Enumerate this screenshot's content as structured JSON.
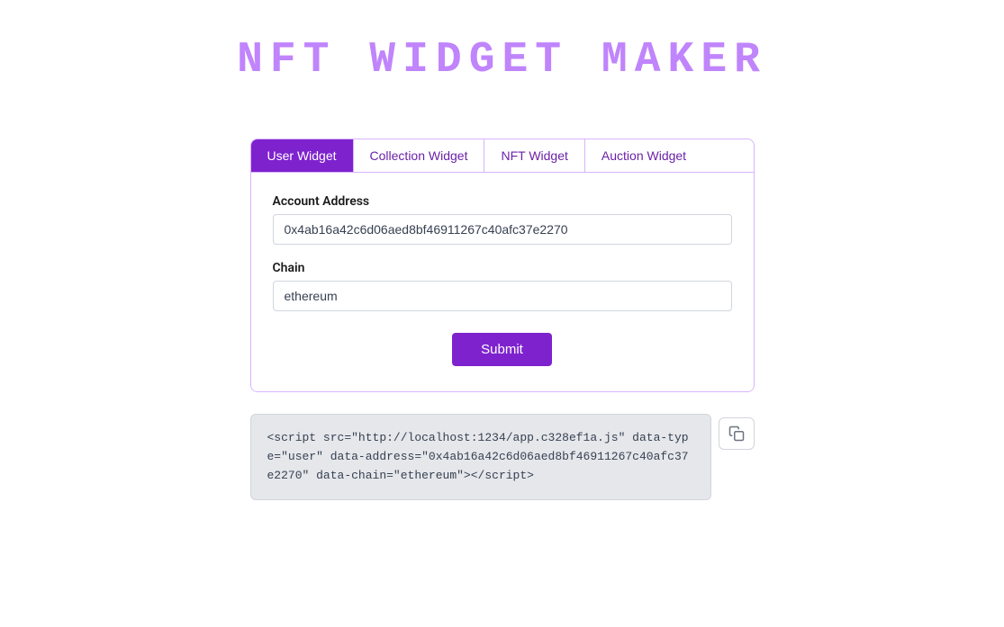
{
  "page": {
    "title": "NFT WIDGET MAKER"
  },
  "tabs": [
    {
      "id": "user",
      "label": "User Widget",
      "active": true
    },
    {
      "id": "collection",
      "label": "Collection Widget",
      "active": false
    },
    {
      "id": "nft",
      "label": "NFT Widget",
      "active": false
    },
    {
      "id": "auction",
      "label": "Auction Widget",
      "active": false
    }
  ],
  "form": {
    "account_address_label": "Account Address",
    "account_address_value": "0x4ab16a42c6d06aed8bf46911267c40afc37e2270",
    "account_address_placeholder": "",
    "chain_label": "Chain",
    "chain_value": "ethereum",
    "chain_placeholder": "",
    "submit_label": "Submit"
  },
  "code_output": {
    "text": "<script src=\"http://localhost:1234/app.c328ef1a.js\" data-type=\"user\" data-address=\"0x4ab16a42c6d06aed8bf46911267c40afc37e2270\" data-chain=\"ethereum\"></script>"
  },
  "icons": {
    "copy": "copy-icon"
  }
}
